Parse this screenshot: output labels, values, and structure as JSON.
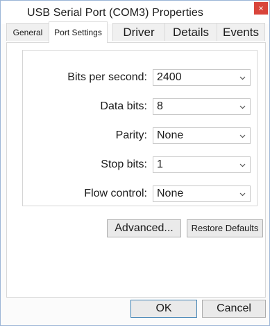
{
  "window": {
    "title": "USB Serial Port (COM3) Properties",
    "close_glyph": "×"
  },
  "tabs": [
    {
      "label": "General"
    },
    {
      "label": "Port Settings"
    },
    {
      "label": "Driver"
    },
    {
      "label": "Details"
    },
    {
      "label": "Events"
    }
  ],
  "active_tab": "Port Settings",
  "settings": {
    "bits_per_second": {
      "label": "Bits per second:",
      "value": "2400"
    },
    "data_bits": {
      "label": "Data bits:",
      "value": "8"
    },
    "parity": {
      "label": "Parity:",
      "value": "None"
    },
    "stop_bits": {
      "label": "Stop bits:",
      "value": "1"
    },
    "flow_control": {
      "label": "Flow control:",
      "value": "None"
    }
  },
  "buttons": {
    "advanced": "Advanced...",
    "restore_defaults": "Restore Defaults",
    "ok": "OK",
    "cancel": "Cancel"
  },
  "icons": {
    "dropdown": "chevron-down-icon",
    "close": "close-icon"
  },
  "colors": {
    "close_button": "#d9453b",
    "window_border": "#9bb5d6",
    "default_button_border": "#3c7fb1"
  }
}
